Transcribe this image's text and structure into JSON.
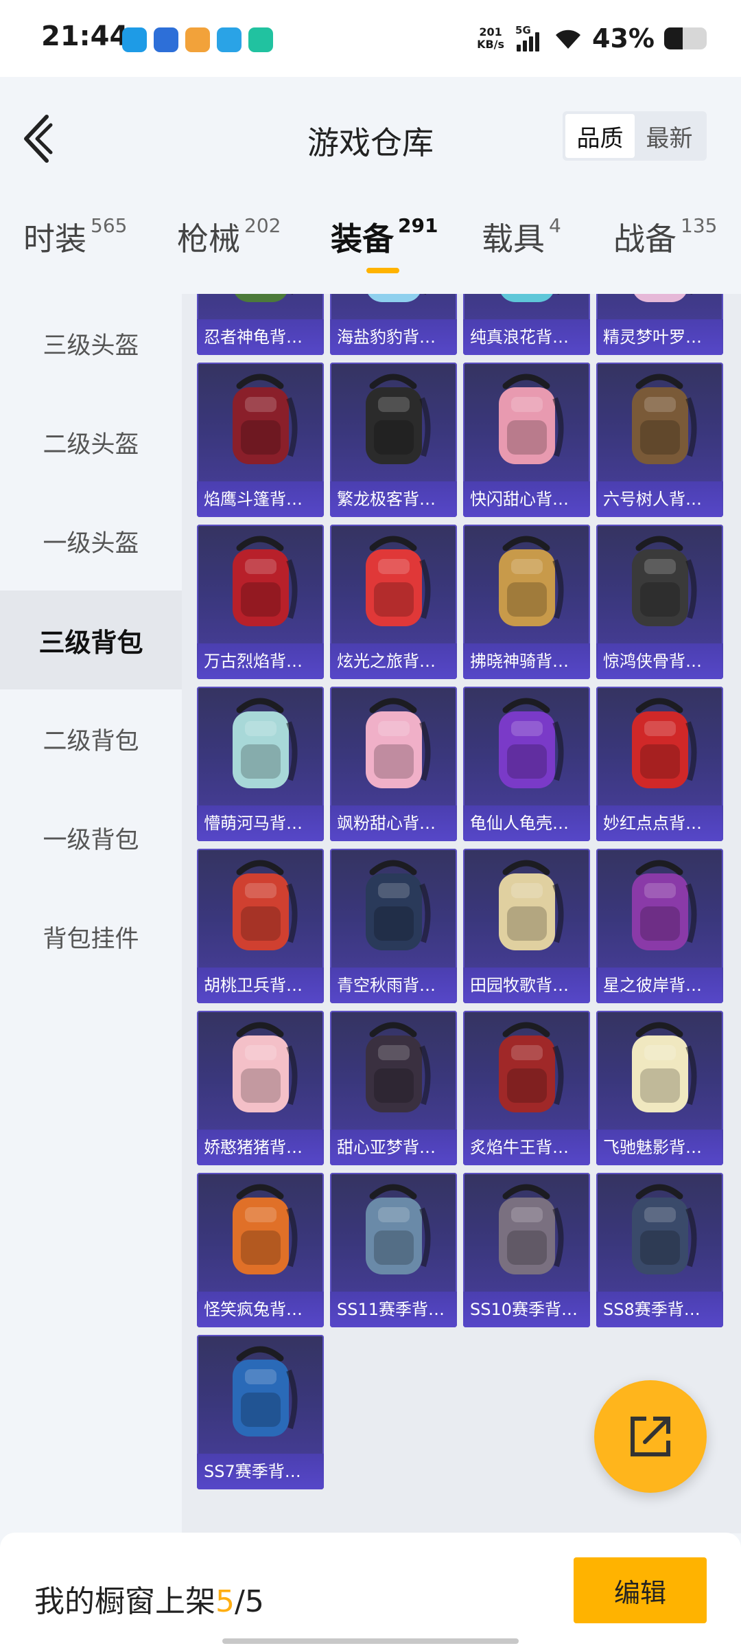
{
  "status_bar": {
    "time": "21:44",
    "net_speed_value": "201",
    "net_speed_unit": "KB/s",
    "network": "5G",
    "battery_pct": "43%",
    "battery_level": 0.43,
    "notification_icons": [
      "app-blue-icon",
      "app-navy-icon",
      "app-orange-icon",
      "telegram-icon",
      "app-green-icon"
    ]
  },
  "header": {
    "title": "游戏仓库",
    "sort_options": [
      "品质",
      "最新"
    ],
    "sort_selected": "品质"
  },
  "category_tabs": [
    {
      "name": "时装",
      "count": "565"
    },
    {
      "name": "枪械",
      "count": "202"
    },
    {
      "name": "装备",
      "count": "291",
      "active": true
    },
    {
      "name": "载具",
      "count": "4"
    },
    {
      "name": "战备",
      "count": "135"
    }
  ],
  "sidebar": {
    "items": [
      "三级头盔",
      "二级头盔",
      "一级头盔",
      "三级背包",
      "二级背包",
      "一级背包",
      "背包挂件"
    ],
    "active": "三级背包"
  },
  "items": [
    {
      "label": "忍者神龟背…",
      "color": "#4c7a3a"
    },
    {
      "label": "海盐豹豹背…",
      "color": "#8fd0ee"
    },
    {
      "label": "纯真浪花背…",
      "color": "#5fc7d9"
    },
    {
      "label": "精灵梦叶罗…",
      "color": "#e6b8d8"
    },
    {
      "label": "焰鹰斗篷背…",
      "color": "#8a1f2a"
    },
    {
      "label": "繁龙极客背…",
      "color": "#2b2b2b"
    },
    {
      "label": "快闪甜心背…",
      "color": "#e89ab0"
    },
    {
      "label": "六号树人背…",
      "color": "#7a5a38"
    },
    {
      "label": "万古烈焰背…",
      "color": "#b8202a"
    },
    {
      "label": "炫光之旅背…",
      "color": "#e03838"
    },
    {
      "label": "拂晓神骑背…",
      "color": "#c89a4a"
    },
    {
      "label": "惊鸿侠骨背…",
      "color": "#3a3a3a"
    },
    {
      "label": "懵萌河马背…",
      "color": "#a8d8d8"
    },
    {
      "label": "飒粉甜心背…",
      "color": "#f0b0c8"
    },
    {
      "label": "龟仙人龟壳…",
      "color": "#7a3ac8"
    },
    {
      "label": "妙红点点背…",
      "color": "#d02828"
    },
    {
      "label": "胡桃卫兵背…",
      "color": "#d04030"
    },
    {
      "label": "青空秋雨背…",
      "color": "#2a3a5a"
    },
    {
      "label": "田园牧歌背…",
      "color": "#e0d0a0"
    },
    {
      "label": "星之彼岸背…",
      "color": "#8a3aa8"
    },
    {
      "label": "娇憨猪猪背…",
      "color": "#f4c0c8"
    },
    {
      "label": "甜心亚梦背…",
      "color": "#3a3040"
    },
    {
      "label": "炙焰牛王背…",
      "color": "#a02828"
    },
    {
      "label": "飞驰魅影背…",
      "color": "#f0e8c0"
    },
    {
      "label": "怪笑疯兔背…",
      "color": "#e07028"
    },
    {
      "label": "SS11赛季背…",
      "color": "#6a8aa8"
    },
    {
      "label": "SS10赛季背…",
      "color": "#7a7080"
    },
    {
      "label": "SS8赛季背…",
      "color": "#3a4a6a"
    },
    {
      "label": "SS7赛季背…",
      "color": "#2a6ab8"
    }
  ],
  "footer": {
    "text_prefix": "我的橱窗上架",
    "count_current": "5",
    "separator": "/",
    "count_total": "5",
    "edit_label": "编辑"
  },
  "colors": {
    "accent": "#ffb300",
    "card_bg": "#3a377c",
    "card_label_bg": "#5647c8"
  }
}
